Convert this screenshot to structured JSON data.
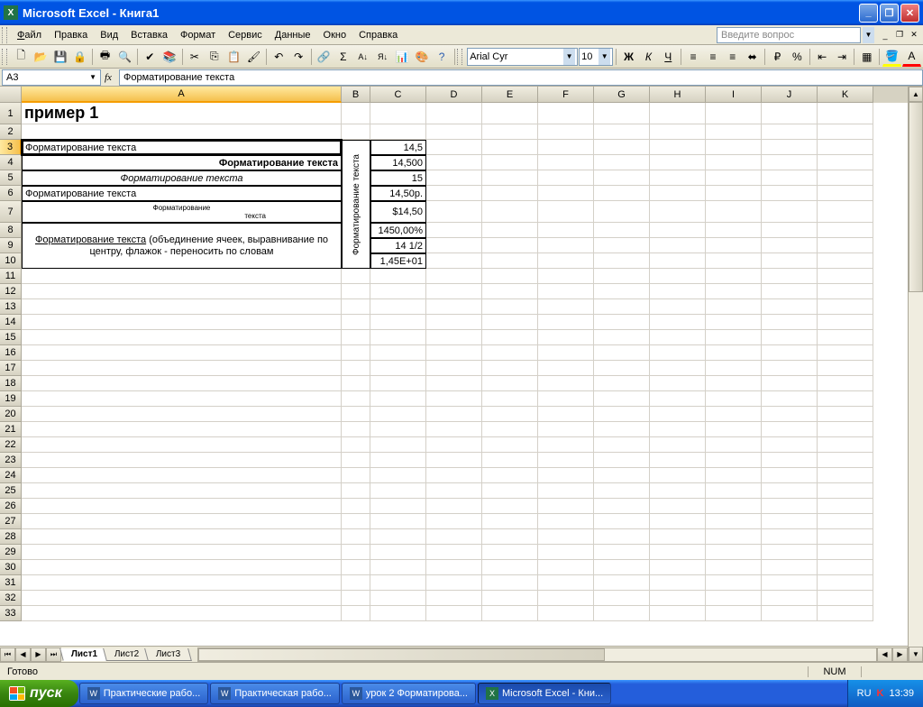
{
  "titlebar": {
    "app": "Microsoft Excel",
    "doc": "Книга1"
  },
  "menu": {
    "file": "Файл",
    "edit": "Правка",
    "view": "Вид",
    "insert": "Вставка",
    "format": "Формат",
    "tools": "Сервис",
    "data": "Данные",
    "window": "Окно",
    "help": "Справка"
  },
  "question_placeholder": "Введите вопрос",
  "font": {
    "name": "Arial Cyr",
    "size": "10"
  },
  "namebox": "A3",
  "fx": "fx",
  "formula": "Форматирование текста",
  "columns": [
    "A",
    "B",
    "C",
    "D",
    "E",
    "F",
    "G",
    "H",
    "I",
    "J",
    "K"
  ],
  "col_widths": {
    "A": 355,
    "B": 32,
    "C": 62,
    "D": 62,
    "E": 62,
    "F": 62,
    "G": 62,
    "H": 62,
    "I": 62,
    "J": 62,
    "K": 62
  },
  "row_heights": {
    "1": 24,
    "2": 17,
    "3": 17,
    "7": 24
  },
  "cells": {
    "A1": "пример 1",
    "A3": "Форматирование текста",
    "A4": "Форматирование текста",
    "A5": "Форматирование текста",
    "A6": "Форматирование текста",
    "A7a": "Форматирование",
    "A7b": "текста",
    "A8": "Форматирование текста (объединение ячеек, выравнивание по центру, флажок - переносить по словам",
    "B3": "Форматирование текста",
    "C3": "14,5",
    "C4": "14,500",
    "C5": "15",
    "C6": "14,50р.",
    "C7": "$14,50",
    "C8": "1450,00%",
    "C9": "14 1/2",
    "C10": "1,45E+01"
  },
  "tabs": {
    "active": "Лист1",
    "t2": "Лист2",
    "t3": "Лист3"
  },
  "status": {
    "ready": "Готово",
    "num": "NUM"
  },
  "taskbar": {
    "start": "пуск",
    "t1": "Практические рабо...",
    "t2": "Практическая рабо...",
    "t3": "урок 2 Форматирова...",
    "t4": "Microsoft Excel - Кни...",
    "lang": "RU",
    "clock": "13:39"
  }
}
